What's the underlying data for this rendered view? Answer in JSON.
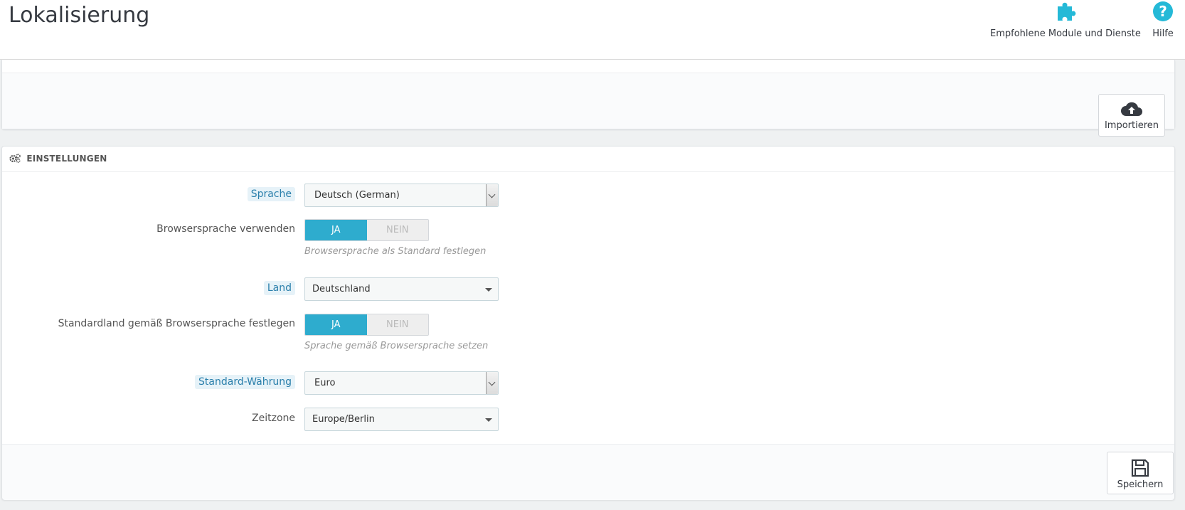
{
  "header": {
    "title": "Lokalisierung",
    "modules_label": "Empfohlene Module und Dienste",
    "help_label": "Hilfe",
    "icon_color": "#25b9d7"
  },
  "import_panel": {
    "import_label": "Importieren"
  },
  "settings": {
    "heading": "EINSTELLUNGEN",
    "language": {
      "label": "Sprache",
      "value": "Deutsch (German)"
    },
    "browser_language": {
      "label": "Browsersprache verwenden",
      "yes": "JA",
      "no": "NEIN",
      "selected": "JA",
      "help": "Browsersprache als Standard festlegen"
    },
    "country": {
      "label": "Land",
      "value": "Deutschland"
    },
    "default_country_browser": {
      "label": "Standardland gemäß Browsersprache festlegen",
      "yes": "JA",
      "no": "NEIN",
      "selected": "JA",
      "help": "Sprache gemäß Browsersprache setzen"
    },
    "currency": {
      "label": "Standard-Währung",
      "value": "Euro"
    },
    "timezone": {
      "label": "Zeitzone",
      "value": "Europe/Berlin"
    },
    "save_label": "Speichern"
  },
  "colors": {
    "accent": "#25b9d7",
    "switch_on": "#2eacce"
  }
}
